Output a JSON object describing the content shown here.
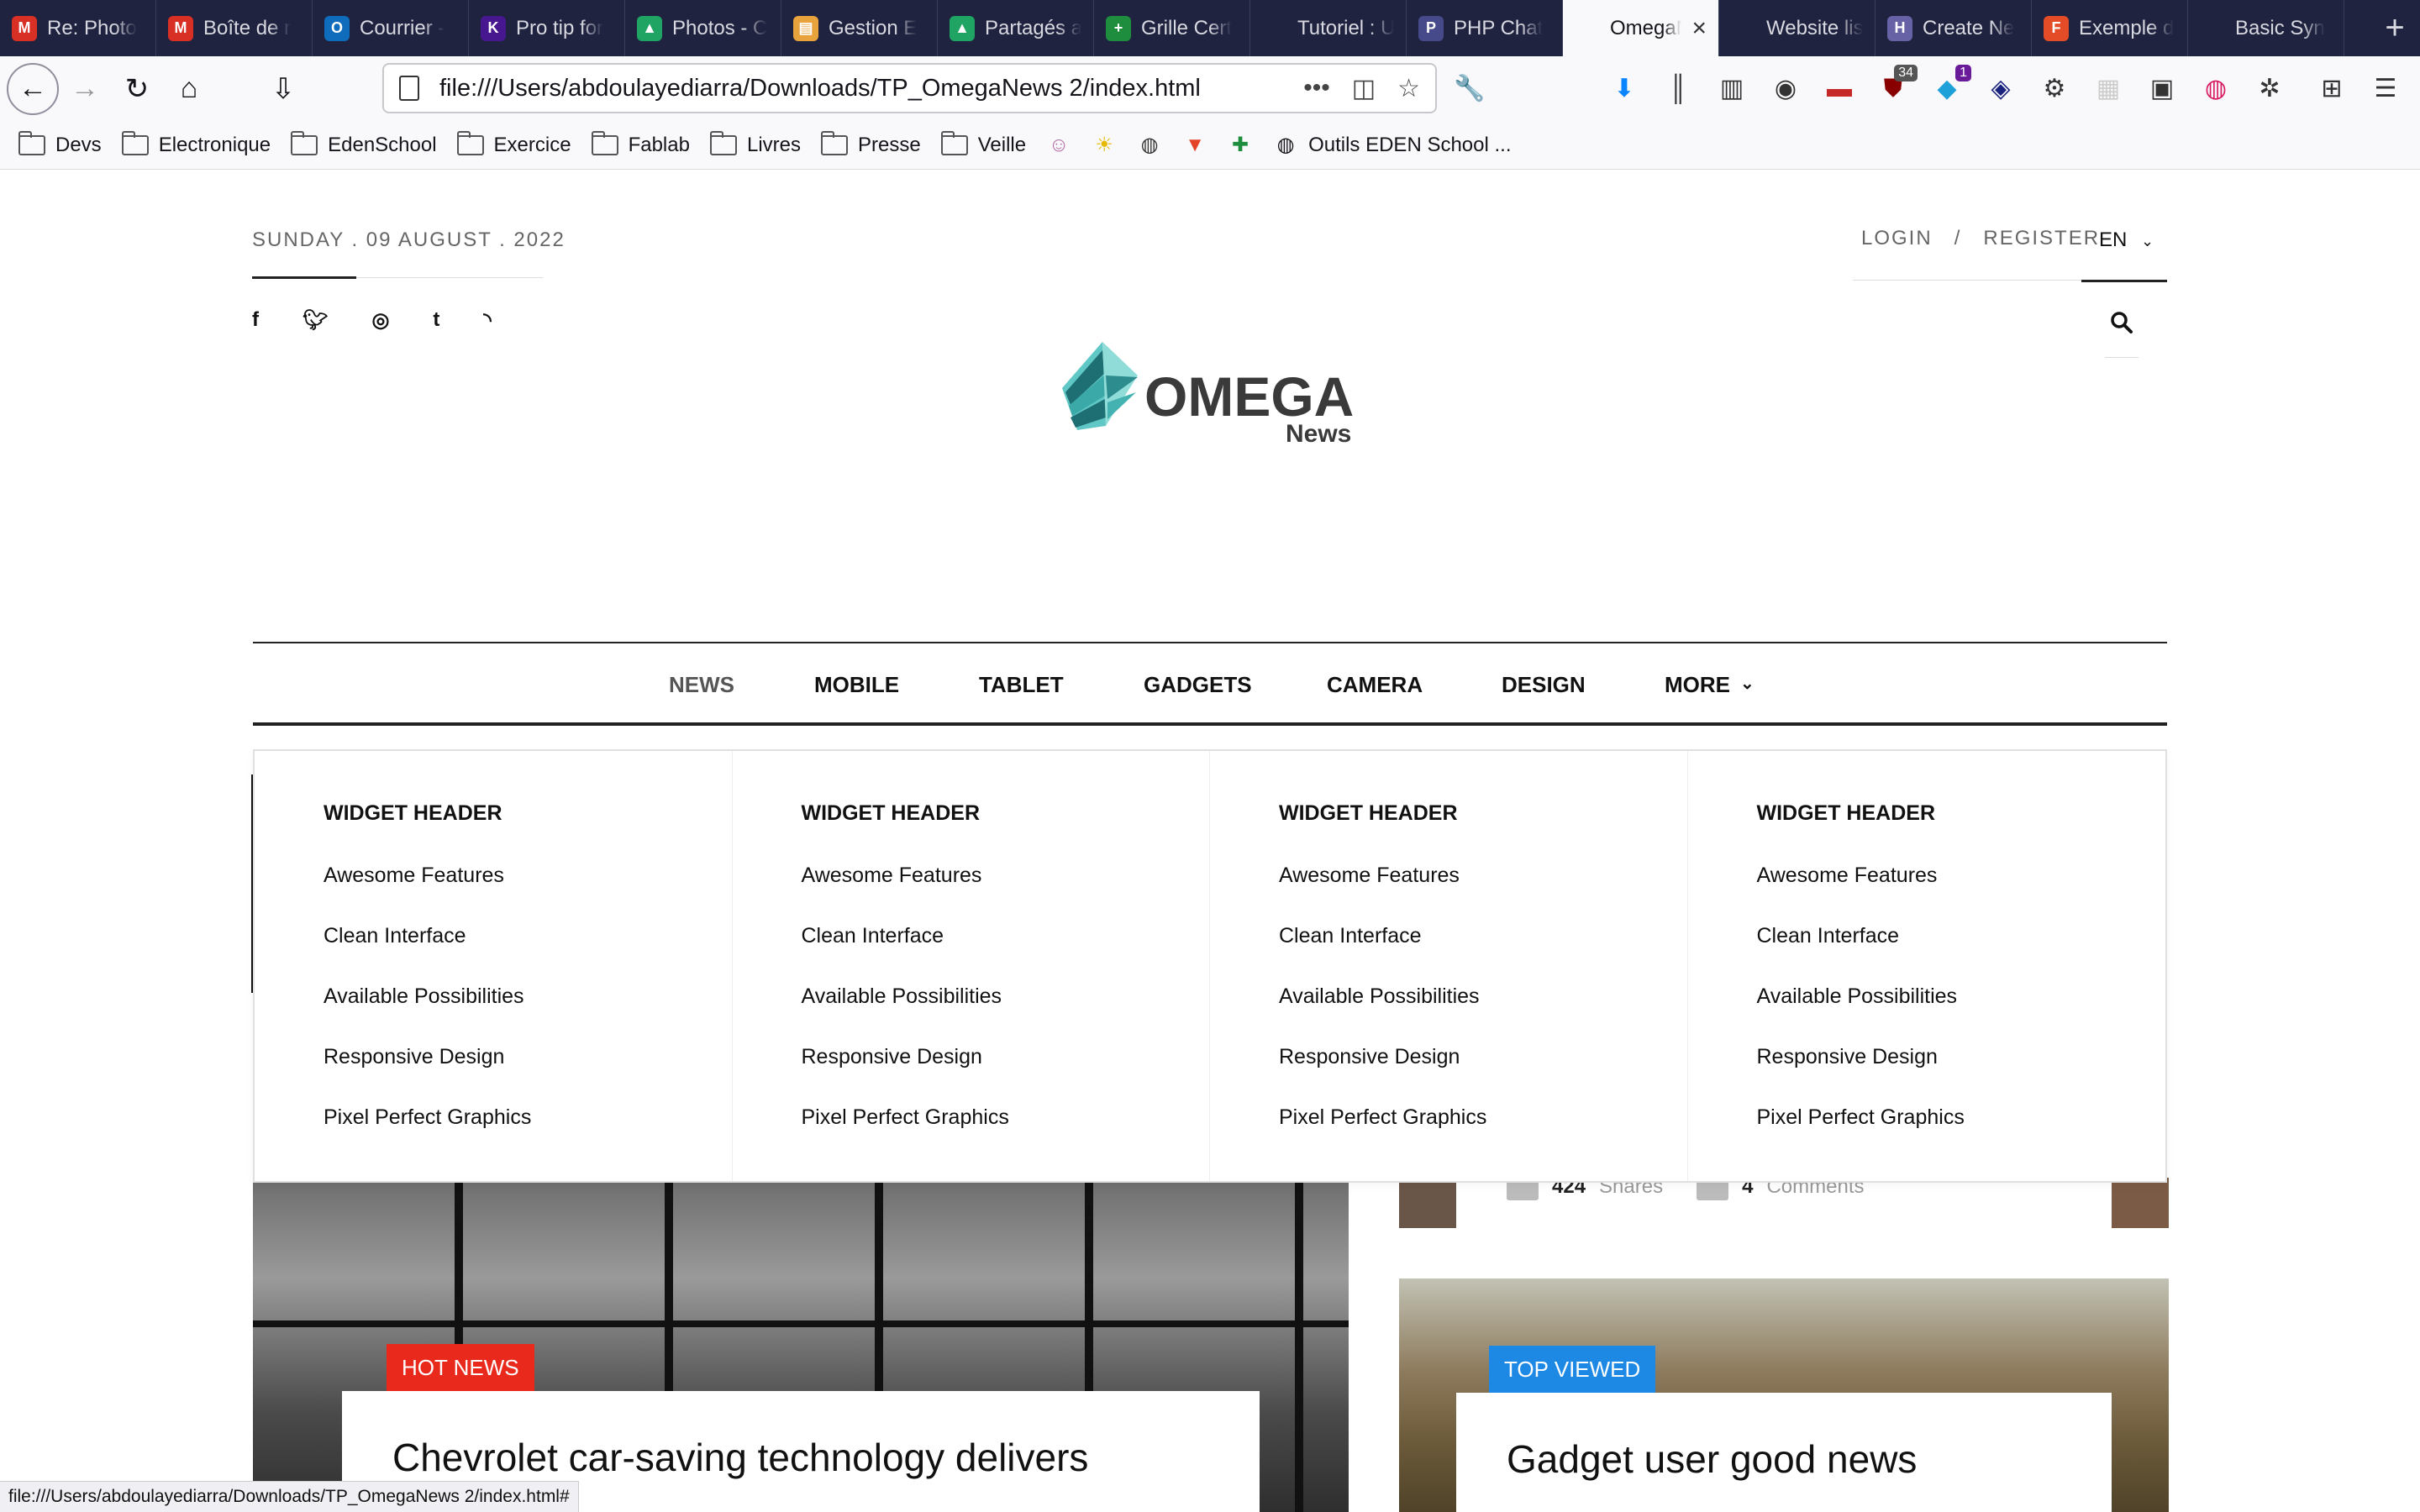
{
  "browser": {
    "tabs": [
      {
        "title": "Re: Photo",
        "icon": "gmail-icon",
        "color": "#d93025",
        "glyph": "M"
      },
      {
        "title": "Boîte de r",
        "icon": "gmail-icon",
        "color": "#d93025",
        "glyph": "M"
      },
      {
        "title": "Courrier -",
        "icon": "outlook-icon",
        "color": "#0f6cbd",
        "glyph": "O"
      },
      {
        "title": "Pro tip for",
        "icon": "kahoot-icon",
        "color": "#46178f",
        "glyph": "K"
      },
      {
        "title": "Photos - C",
        "icon": "drive-icon",
        "color": "#1fa463",
        "glyph": "▲"
      },
      {
        "title": "Gestion E",
        "icon": "book-icon",
        "color": "#e8a33d",
        "glyph": "▤"
      },
      {
        "title": "Partagés a",
        "icon": "drive-icon",
        "color": "#1fa463",
        "glyph": "▲"
      },
      {
        "title": "Grille Cert",
        "icon": "sheets-icon",
        "color": "#1e8e3e",
        "glyph": "+"
      },
      {
        "title": "Tutoriel : Un c",
        "icon": "",
        "color": "transparent",
        "glyph": ""
      },
      {
        "title": "PHP Chat",
        "icon": "php-icon",
        "color": "#474a8a",
        "glyph": "P"
      },
      {
        "title": "OmegaNe",
        "icon": "",
        "color": "transparent",
        "glyph": "",
        "active": true
      },
      {
        "title": "Website list",
        "icon": "",
        "color": "transparent",
        "glyph": ""
      },
      {
        "title": "Create Ne",
        "icon": "heroku-icon",
        "color": "#6762a6",
        "glyph": "H"
      },
      {
        "title": "Exemple d",
        "icon": "f-icon",
        "color": "#e34c26",
        "glyph": "F"
      },
      {
        "title": "Basic Syn",
        "icon": "",
        "color": "transparent",
        "glyph": ""
      }
    ],
    "url": "file:///Users/abdoulayediarra/Downloads/TP_OmegaNews 2/index.html",
    "badges": {
      "ublock": "34",
      "notif": "1"
    },
    "bookmarks": [
      "Devs",
      "Electronique",
      "EdenSchool",
      "Exercice",
      "Fablab",
      "Livres",
      "Presse",
      "Veille"
    ],
    "bookmark_last": "Outils EDEN School ...",
    "status_url": "file:///Users/abdoulayediarra/Downloads/TP_OmegaNews 2/index.html#"
  },
  "site": {
    "date": "SUNDAY . 09 AUGUST . 2022",
    "login": "LOGIN",
    "separator": "/",
    "register": "REGISTER",
    "language": "EN",
    "logo": {
      "word": "OMEGA",
      "sub": "News"
    },
    "nav": [
      "NEWS",
      "MOBILE",
      "TABLET",
      "GADGETS",
      "CAMERA",
      "DESIGN",
      "MORE"
    ],
    "mega_menu": [
      {
        "header": "WIDGET HEADER",
        "items": [
          "Awesome Features",
          "Clean Interface",
          "Available Possibilities",
          "Responsive Design",
          "Pixel Perfect Graphics"
        ]
      },
      {
        "header": "WIDGET HEADER",
        "items": [
          "Awesome Features",
          "Clean Interface",
          "Available Possibilities",
          "Responsive Design",
          "Pixel Perfect Graphics"
        ]
      },
      {
        "header": "WIDGET HEADER",
        "items": [
          "Awesome Features",
          "Clean Interface",
          "Available Possibilities",
          "Responsive Design",
          "Pixel Perfect Graphics"
        ]
      },
      {
        "header": "WIDGET HEADER",
        "items": [
          "Awesome Features",
          "Clean Interface",
          "Available Possibilities",
          "Responsive Design",
          "Pixel Perfect Graphics"
        ]
      }
    ],
    "meta": {
      "shares_count": "424",
      "shares_label": "Shares",
      "comments_count": "4",
      "comments_label": "Comments"
    },
    "articles": [
      {
        "badge": "HOT NEWS",
        "badge_color": "#e8291c",
        "title": "Chevrolet car-saving technology delivers"
      },
      {
        "badge": "TOP VIEWED",
        "badge_color": "#1e88e5",
        "title": "Gadget user good news"
      }
    ]
  }
}
